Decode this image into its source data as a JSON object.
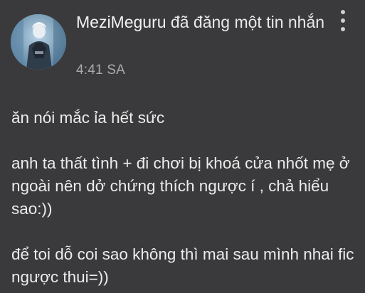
{
  "post": {
    "author": "MeziMeguru",
    "action_text": " đã đăng một tin nhắn",
    "time": "4:41 SA",
    "avatar_icon": "user-avatar",
    "menu_icon": "more-vertical-icon"
  },
  "message": {
    "paragraphs": [
      "ăn nói mắc ỉa hết sức",
      "anh ta thất tình + đi chơi bị khoá cửa nhốt mẹ ở ngoài nên dở chứng thích ngược í , chả hiểu sao:))",
      "để toi dỗ coi sao không thì mai sau mình nhai fic ngược thui=))"
    ]
  },
  "colors": {
    "background": "#3a3a3c",
    "text": "#ececec",
    "muted": "#a9a9ab"
  }
}
